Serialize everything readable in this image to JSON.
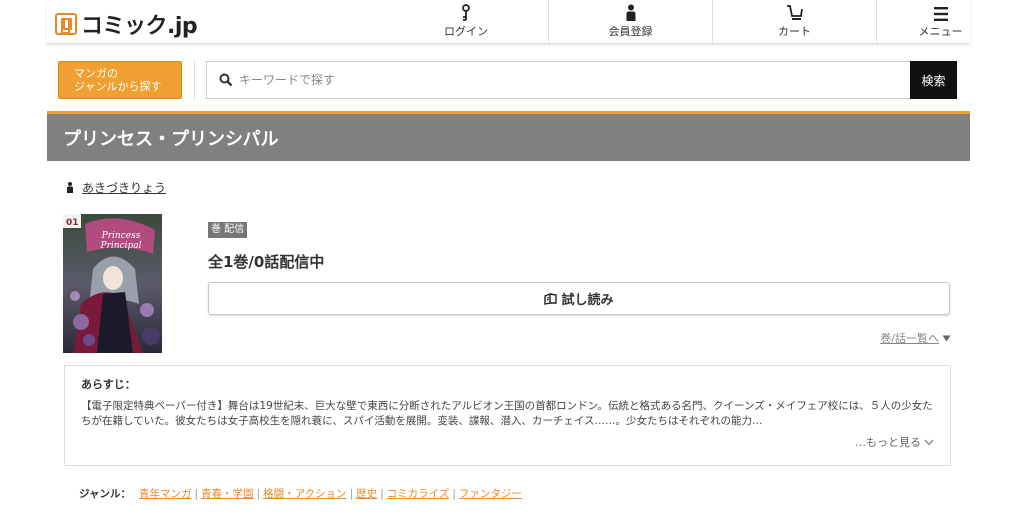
{
  "header": {
    "logo_text": "コミック.jp",
    "nav": [
      {
        "label": "ログイン",
        "icon": "key-icon"
      },
      {
        "label": "会員登録",
        "icon": "person-icon"
      },
      {
        "label": "カート",
        "icon": "cart-icon"
      },
      {
        "label": "メニュー",
        "icon": "menu-icon"
      }
    ]
  },
  "search": {
    "genre_button": [
      "マンガの",
      "ジャンルから探す"
    ],
    "placeholder": "キーワードで探す",
    "button_label": "検索"
  },
  "title": "プリンセス・プリンシパル",
  "author": "あきづきりょう",
  "badge": "巻 配信",
  "volume_count": "全1巻/0話配信中",
  "trial_button": "試し読み",
  "episode_list_link": "巻/話一覧へ",
  "synopsis": {
    "heading": "あらすじ：",
    "body": "【電子限定特典ペーパー付き】舞台は19世紀末、巨大な壁で東西に分断されたアルビオン王国の首都ロンドン。伝統と格式ある名門、クイーンズ・メイフェア校には、５人の少女たちが在籍していた。彼女たちは女子高校生を隠れ蓑に、スパイ活動を展開。変装、諜報、潜入、カーチェイス……。少女たちはそれぞれの能力…",
    "more": "…もっと見る"
  },
  "genres": {
    "label": "ジャンル：",
    "items": [
      "青年マンガ",
      "青春・学園",
      "格闘・アクション",
      "歴史",
      "コミカライズ",
      "ファンタジー"
    ]
  },
  "colors": {
    "accent": "#f0a030",
    "title_bar": "#808080",
    "link": "#e8882a"
  }
}
